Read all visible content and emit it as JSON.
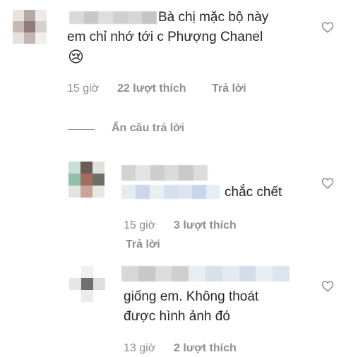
{
  "comments": [
    {
      "text_line1": "Bà chị mặc bộ này",
      "text_line2": "em chỉ nhớ tới c Phượng Chanel",
      "emoji": "😢",
      "time": "15 giờ",
      "likes": "22 lượt thích",
      "reply": "Trả lời"
    }
  ],
  "hide_replies": "Ẩn câu trả lời",
  "replies": [
    {
      "text": "chắc chết",
      "time": "15 giờ",
      "likes": "3 lượt thích",
      "reply": "Trả lời"
    },
    {
      "text_line1": "giống em. Không thoát",
      "text_line2": "được hình ảnh đó",
      "time": "13 giờ",
      "likes": "2 lượt thích"
    }
  ],
  "icons": [
    "heart-icon"
  ]
}
